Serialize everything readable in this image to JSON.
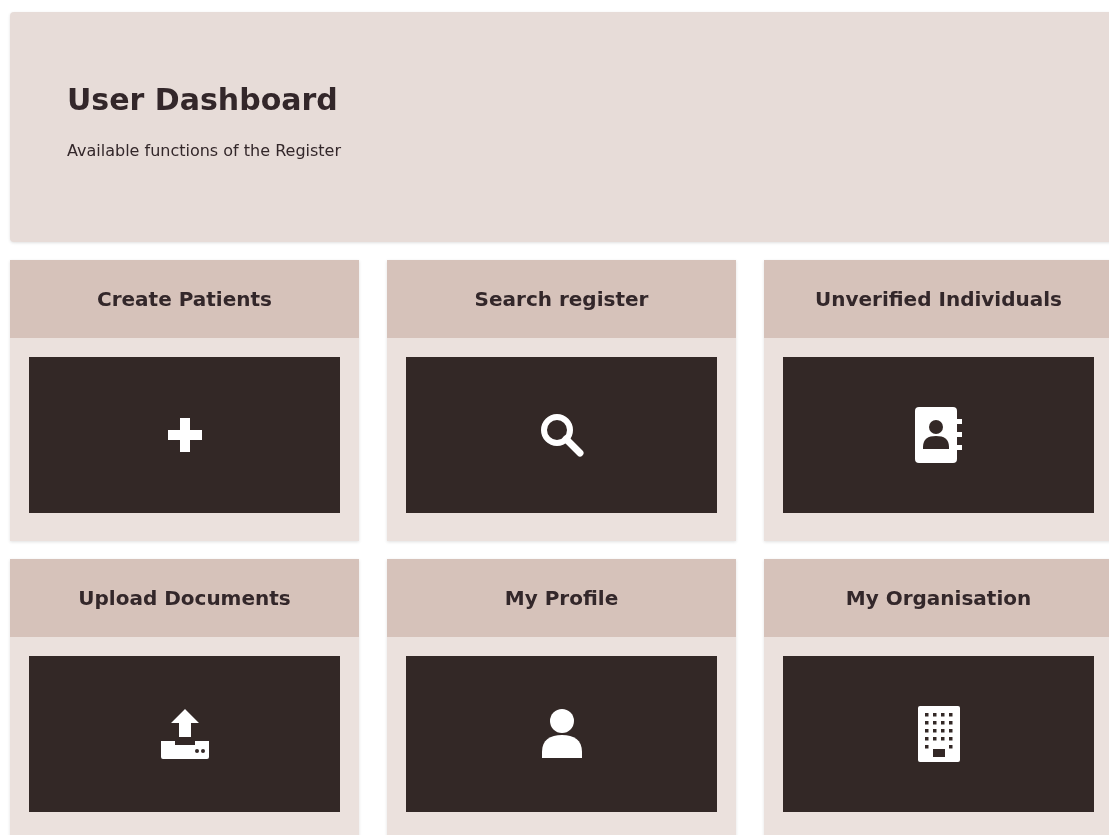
{
  "header": {
    "title": "User Dashboard",
    "subtitle": "Available functions of the Register"
  },
  "tiles": [
    {
      "label": "Create Patients",
      "kind": "plus"
    },
    {
      "label": "Search register",
      "kind": "search"
    },
    {
      "label": "Unverified Individuals",
      "kind": "contacts"
    },
    {
      "label": "Upload Documents",
      "kind": "upload"
    },
    {
      "label": "My Profile",
      "kind": "user"
    },
    {
      "label": "My Organisation",
      "kind": "building"
    }
  ]
}
